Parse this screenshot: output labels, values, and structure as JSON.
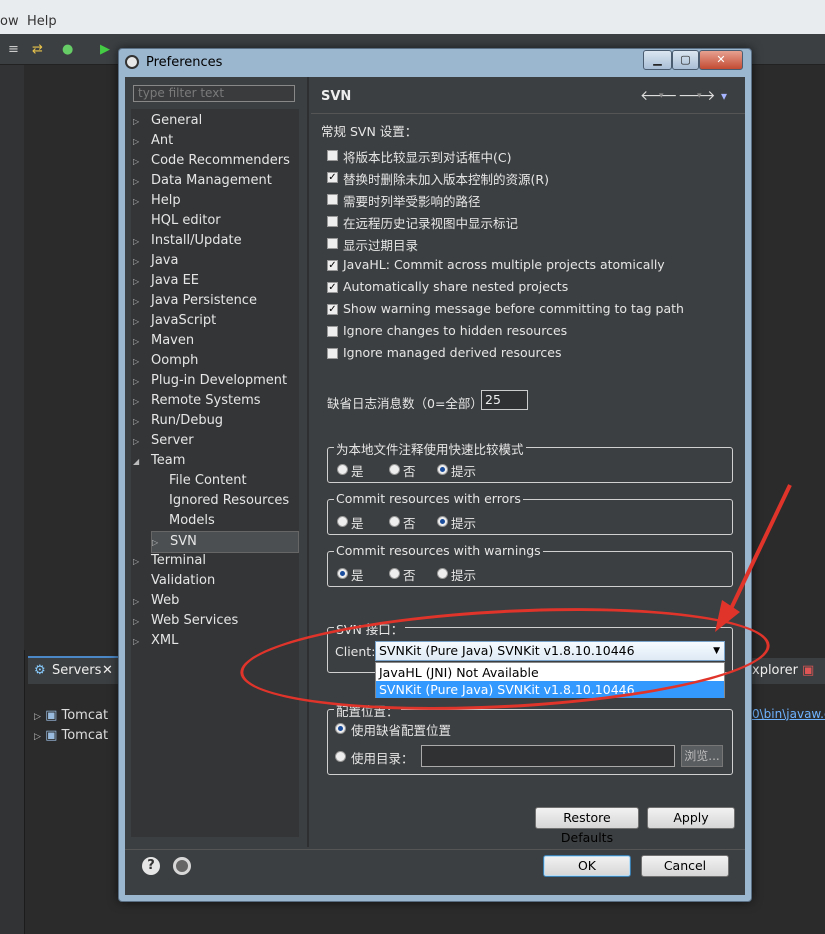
{
  "ide": {
    "menu": [
      "ow",
      "Help"
    ],
    "servers_tab": "Servers",
    "servers": [
      "Tomcat",
      "Tomcat"
    ],
    "right_tab": "xplorer",
    "right_path": "0\\bin\\javaw.e"
  },
  "dialog": {
    "title": "Preferences",
    "filter_placeholder": "type filter text",
    "tree": [
      {
        "label": "General",
        "arrow": "▷",
        "indent": 0
      },
      {
        "label": "Ant",
        "arrow": "▷",
        "indent": 0
      },
      {
        "label": "Code Recommenders",
        "arrow": "▷",
        "indent": 0
      },
      {
        "label": "Data Management",
        "arrow": "▷",
        "indent": 0
      },
      {
        "label": "Help",
        "arrow": "▷",
        "indent": 0
      },
      {
        "label": "HQL editor",
        "arrow": "",
        "indent": 0
      },
      {
        "label": "Install/Update",
        "arrow": "▷",
        "indent": 0
      },
      {
        "label": "Java",
        "arrow": "▷",
        "indent": 0
      },
      {
        "label": "Java EE",
        "arrow": "▷",
        "indent": 0
      },
      {
        "label": "Java Persistence",
        "arrow": "▷",
        "indent": 0
      },
      {
        "label": "JavaScript",
        "arrow": "▷",
        "indent": 0
      },
      {
        "label": "Maven",
        "arrow": "▷",
        "indent": 0
      },
      {
        "label": "Oomph",
        "arrow": "▷",
        "indent": 0
      },
      {
        "label": "Plug-in Development",
        "arrow": "▷",
        "indent": 0
      },
      {
        "label": "Remote Systems",
        "arrow": "▷",
        "indent": 0
      },
      {
        "label": "Run/Debug",
        "arrow": "▷",
        "indent": 0
      },
      {
        "label": "Server",
        "arrow": "▷",
        "indent": 0
      },
      {
        "label": "Team",
        "arrow": "◢",
        "indent": 0
      },
      {
        "label": "File Content",
        "arrow": "",
        "indent": 1
      },
      {
        "label": "Ignored Resources",
        "arrow": "",
        "indent": 1
      },
      {
        "label": "Models",
        "arrow": "",
        "indent": 1
      },
      {
        "label": "SVN",
        "arrow": "▷",
        "indent": 1,
        "selected": true
      },
      {
        "label": "Terminal",
        "arrow": "▷",
        "indent": 0
      },
      {
        "label": "Validation",
        "arrow": "",
        "indent": 0
      },
      {
        "label": "Web",
        "arrow": "▷",
        "indent": 0
      },
      {
        "label": "Web Services",
        "arrow": "▷",
        "indent": 0
      },
      {
        "label": "XML",
        "arrow": "▷",
        "indent": 0
      }
    ],
    "page_title": "SVN",
    "section_label": "常规 SVN 设置：",
    "checkboxes": [
      {
        "label": "将版本比较显示到对话框中(C)",
        "checked": false
      },
      {
        "label": "替换时删除未加入版本控制的资源(R)",
        "checked": true
      },
      {
        "label": "需要时列举受影响的路径",
        "checked": false
      },
      {
        "label": "在远程历史记录视图中显示标记",
        "checked": false
      },
      {
        "label": "显示过期目录",
        "checked": false
      },
      {
        "label": "JavaHL: Commit across multiple projects atomically",
        "checked": true
      },
      {
        "label": "Automatically share nested projects",
        "checked": true
      },
      {
        "label": "Show warning message before committing to tag path",
        "checked": true
      },
      {
        "label": "Ignore changes to hidden resources",
        "checked": false
      },
      {
        "label": "Ignore managed derived resources",
        "checked": false
      }
    ],
    "log_label": "缺省日志消息数（0=全部）",
    "log_value": "25",
    "groups": [
      {
        "legend": "为本地文件注释使用快速比较模式",
        "options": [
          "是",
          "否",
          "提示"
        ],
        "selected": 2
      },
      {
        "legend": "Commit resources with errors",
        "options": [
          "是",
          "否",
          "提示"
        ],
        "selected": 2
      },
      {
        "legend": "Commit resources with warnings",
        "options": [
          "是",
          "否",
          "提示"
        ],
        "selected": 0
      }
    ],
    "svn_interface": {
      "legend": "SVN 接口：",
      "client_label": "Client:",
      "client_value": "SVNKit (Pure Java) SVNKit v1.8.10.10446",
      "options": [
        "JavaHL (JNI) Not Available",
        "SVNKit (Pure Java) SVNKit v1.8.10.10446"
      ],
      "selected": 1
    },
    "config": {
      "legend": "配置位置：",
      "default_label": "使用缺省配置位置",
      "dir_label": "使用目录：",
      "browse": "浏览...",
      "selected": 0
    },
    "buttons": {
      "restore": "Restore Defaults",
      "apply": "Apply",
      "ok": "OK",
      "cancel": "Cancel"
    },
    "help_glyph": "?",
    "nav": {
      "back": "🡐",
      "forward": "🡒",
      "menu": "▾",
      "drop": "▾"
    }
  },
  "icons": [
    "help-icon",
    "gear-icon",
    "back-arrow-icon",
    "forward-arrow-icon",
    "close-icon"
  ],
  "colors": {
    "annotation": "#e0342b",
    "selection": "#3399ff"
  }
}
